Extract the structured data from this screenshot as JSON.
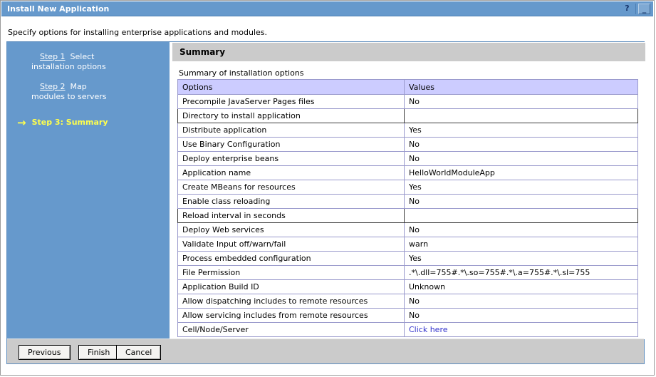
{
  "window": {
    "title": "Install New Application",
    "controls": {
      "help": "?",
      "minimize": "_"
    }
  },
  "intro_text": "Specify options for installing enterprise applications and modules.",
  "sidebar": {
    "steps": [
      {
        "link": "Step 1",
        "rest_line1": "Select",
        "line2": "installation options"
      },
      {
        "link": "Step 2",
        "rest_line1": "Map",
        "line2": "modules to servers"
      },
      {
        "label": "Step 3: Summary",
        "arrow": "→"
      }
    ]
  },
  "content": {
    "section_title": "Summary",
    "caption": "Summary of installation options",
    "table": {
      "headers": {
        "options": "Options",
        "values": "Values"
      },
      "rows": [
        {
          "option": "Precompile JavaServer Pages files",
          "value": "No"
        },
        {
          "option": "Directory to install application",
          "value": ""
        },
        {
          "option": "Distribute application",
          "value": "Yes"
        },
        {
          "option": "Use Binary Configuration",
          "value": "No"
        },
        {
          "option": "Deploy enterprise beans",
          "value": "No"
        },
        {
          "option": "Application name",
          "value": "HelloWorldModuleApp"
        },
        {
          "option": "Create MBeans for resources",
          "value": "Yes"
        },
        {
          "option": "Enable class reloading",
          "value": "No"
        },
        {
          "option": "Reload interval in seconds",
          "value": ""
        },
        {
          "option": "Deploy Web services",
          "value": "No"
        },
        {
          "option": "Validate Input off/warn/fail",
          "value": "warn"
        },
        {
          "option": "Process embedded configuration",
          "value": "Yes"
        },
        {
          "option": "File Permission",
          "value": ".*\\.dll=755#.*\\.so=755#.*\\.a=755#.*\\.sl=755"
        },
        {
          "option": "Application Build ID",
          "value": "Unknown"
        },
        {
          "option": "Allow dispatching includes to remote resources",
          "value": "No"
        },
        {
          "option": "Allow servicing includes from remote resources",
          "value": "No"
        },
        {
          "option": "Cell/Node/Server",
          "value": "Click here"
        }
      ]
    }
  },
  "buttons": {
    "previous": "Previous",
    "finish": "Finish",
    "cancel": "Cancel"
  },
  "colors": {
    "titlebar": "#6699cc",
    "sidebar": "#6699cc",
    "active_step": "#ffff4d",
    "table_header_bg": "#ccccff",
    "table_border": "#9999cc",
    "link": "#3333cc",
    "bar_gray": "#cbcbcb"
  }
}
